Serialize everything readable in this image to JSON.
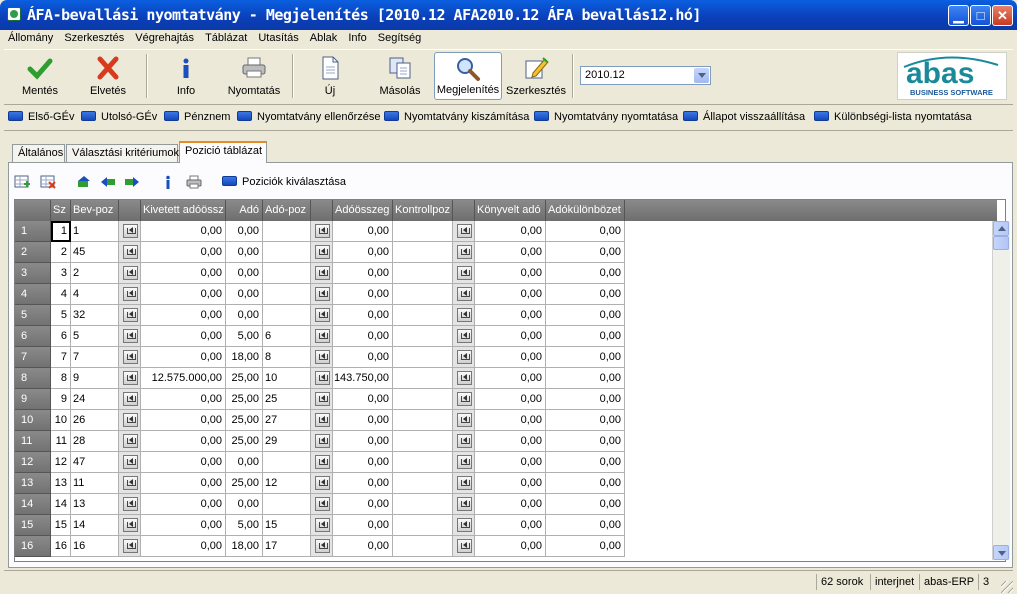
{
  "window": {
    "title": "ÁFA-bevallási nyomtatvány - Megjelenítés  [2010.12  AFA2010.12  ÁFA bevallás12.hó]",
    "colors": {
      "titlebar": "#0b3fb8",
      "tab_accent": "#e68b2c",
      "chip": "#1648b8"
    }
  },
  "menu": [
    "Állomány",
    "Szerkesztés",
    "Végrehajtás",
    "Táblázat",
    "Utasítás",
    "Ablak",
    "Info",
    "Segítség"
  ],
  "toolbar": {
    "buttons": [
      {
        "label": "Mentés",
        "icon": "checkmark-icon"
      },
      {
        "label": "Elvetés",
        "icon": "cross-icon"
      },
      {
        "label": "Info",
        "icon": "info-icon"
      },
      {
        "label": "Nyomtatás",
        "icon": "printer-icon"
      },
      {
        "label": "Új",
        "icon": "new-document-icon"
      },
      {
        "label": "Másolás",
        "icon": "copy-icon"
      },
      {
        "label": "Megjelenítés",
        "icon": "magnifier-icon"
      },
      {
        "label": "Szerkesztés",
        "icon": "edit-pencil-icon"
      }
    ],
    "active": "Megjelenítés",
    "period_value": "2010.12"
  },
  "logo": {
    "text": "abas",
    "subtext": "BUSINESS SOFTWARE"
  },
  "actions": [
    "Első-GÉv",
    "Utolsó-GÉv",
    "Pénznem",
    "Nyomtatvány ellenőrzése",
    "Nyomtatvány kiszámítása",
    "Nyomtatvány nyomtatása",
    "Állapot visszaállítása",
    "Különbségi-lista nyomtatása"
  ],
  "tabs": [
    "Általános",
    "Választási kritériumok",
    "Pozició táblázat"
  ],
  "selected_tab": "Pozició táblázat",
  "subtoolbar": {
    "select_positions": "Poziciók kiválasztása"
  },
  "table": {
    "columns": [
      "Sz",
      "Bev-poz",
      "",
      "Kivetett adóössz",
      "Adó",
      "Adó-poz",
      "",
      "Adóösszeg",
      "Kontrollpoz",
      "",
      "Könyvelt adó",
      "Adókülönbözet"
    ],
    "rows": [
      {
        "n": "1",
        "sz": "1",
        "bev": "1",
        "kiv": "0,00",
        "ado": "0,00",
        "adopoz": "",
        "adoossz": "0,00",
        "kontroll": "",
        "konyv": "0,00",
        "kul": "0,00"
      },
      {
        "n": "2",
        "sz": "2",
        "bev": "45",
        "kiv": "0,00",
        "ado": "0,00",
        "adopoz": "",
        "adoossz": "0,00",
        "kontroll": "",
        "konyv": "0,00",
        "kul": "0,00"
      },
      {
        "n": "3",
        "sz": "3",
        "bev": "2",
        "kiv": "0,00",
        "ado": "0,00",
        "adopoz": "",
        "adoossz": "0,00",
        "kontroll": "",
        "konyv": "0,00",
        "kul": "0,00"
      },
      {
        "n": "4",
        "sz": "4",
        "bev": "4",
        "kiv": "0,00",
        "ado": "0,00",
        "adopoz": "",
        "adoossz": "0,00",
        "kontroll": "",
        "konyv": "0,00",
        "kul": "0,00"
      },
      {
        "n": "5",
        "sz": "5",
        "bev": "32",
        "kiv": "0,00",
        "ado": "0,00",
        "adopoz": "",
        "adoossz": "0,00",
        "kontroll": "",
        "konyv": "0,00",
        "kul": "0,00"
      },
      {
        "n": "6",
        "sz": "6",
        "bev": "5",
        "kiv": "0,00",
        "ado": "5,00",
        "adopoz": "6",
        "adoossz": "0,00",
        "kontroll": "",
        "konyv": "0,00",
        "kul": "0,00"
      },
      {
        "n": "7",
        "sz": "7",
        "bev": "7",
        "kiv": "0,00",
        "ado": "18,00",
        "adopoz": "8",
        "adoossz": "0,00",
        "kontroll": "",
        "konyv": "0,00",
        "kul": "0,00"
      },
      {
        "n": "8",
        "sz": "8",
        "bev": "9",
        "kiv": "12.575.000,00",
        "ado": "25,00",
        "adopoz": "10",
        "adoossz": "143.750,00",
        "kontroll": "",
        "konyv": "0,00",
        "kul": "0,00"
      },
      {
        "n": "9",
        "sz": "9",
        "bev": "24",
        "kiv": "0,00",
        "ado": "25,00",
        "adopoz": "25",
        "adoossz": "0,00",
        "kontroll": "",
        "konyv": "0,00",
        "kul": "0,00"
      },
      {
        "n": "10",
        "sz": "10",
        "bev": "26",
        "kiv": "0,00",
        "ado": "25,00",
        "adopoz": "27",
        "adoossz": "0,00",
        "kontroll": "",
        "konyv": "0,00",
        "kul": "0,00"
      },
      {
        "n": "11",
        "sz": "11",
        "bev": "28",
        "kiv": "0,00",
        "ado": "25,00",
        "adopoz": "29",
        "adoossz": "0,00",
        "kontroll": "",
        "konyv": "0,00",
        "kul": "0,00"
      },
      {
        "n": "12",
        "sz": "12",
        "bev": "47",
        "kiv": "0,00",
        "ado": "0,00",
        "adopoz": "",
        "adoossz": "0,00",
        "kontroll": "",
        "konyv": "0,00",
        "kul": "0,00"
      },
      {
        "n": "13",
        "sz": "13",
        "bev": "11",
        "kiv": "0,00",
        "ado": "25,00",
        "adopoz": "12",
        "adoossz": "0,00",
        "kontroll": "",
        "konyv": "0,00",
        "kul": "0,00"
      },
      {
        "n": "14",
        "sz": "14",
        "bev": "13",
        "kiv": "0,00",
        "ado": "0,00",
        "adopoz": "",
        "adoossz": "0,00",
        "kontroll": "",
        "konyv": "0,00",
        "kul": "0,00"
      },
      {
        "n": "15",
        "sz": "15",
        "bev": "14",
        "kiv": "0,00",
        "ado": "5,00",
        "adopoz": "15",
        "adoossz": "0,00",
        "kontroll": "",
        "konyv": "0,00",
        "kul": "0,00"
      },
      {
        "n": "16",
        "sz": "16",
        "bev": "16",
        "kiv": "0,00",
        "ado": "18,00",
        "adopoz": "17",
        "adoossz": "0,00",
        "kontroll": "",
        "konyv": "0,00",
        "kul": "0,00"
      }
    ]
  },
  "status": {
    "rows": "62 sorok",
    "channel": "interjnet",
    "app": "abas-ERP",
    "num": "3"
  }
}
